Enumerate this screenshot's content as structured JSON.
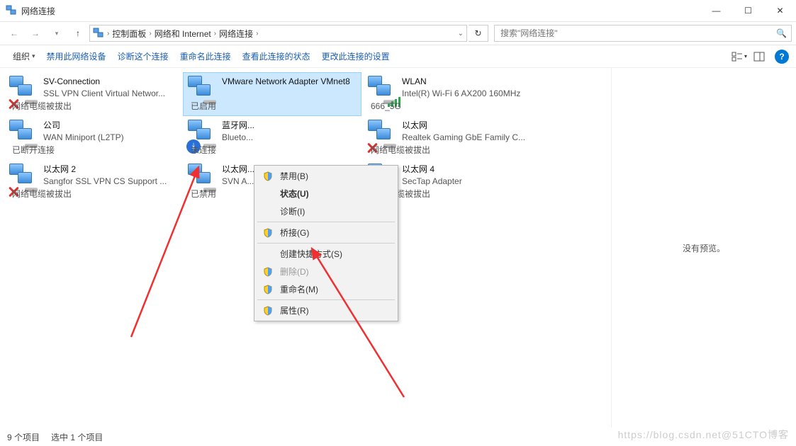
{
  "window": {
    "title": "网络连接",
    "winbuttons": {
      "min": "—",
      "max": "☐",
      "close": "✕"
    }
  },
  "nav": {
    "crumbs": [
      "控制面板",
      "网络和 Internet",
      "网络连接"
    ],
    "search_placeholder": "搜索\"网络连接\""
  },
  "cmdbar": {
    "organize": "组织",
    "disable": "禁用此网络设备",
    "diagnose": "诊断这个连接",
    "rename": "重命名此连接",
    "viewstatus": "查看此连接的状态",
    "changeconn": "更改此连接的设置"
  },
  "connections": [
    {
      "name": "SV-Connection",
      "status": "网络电缆被拔出",
      "device": "SSL VPN Client Virtual Networ...",
      "badge": "x"
    },
    {
      "name": "VMware Network Adapter VMnet8",
      "status": "已启用",
      "device": "",
      "badge": "",
      "selected": true
    },
    {
      "name": "WLAN",
      "status": "666_5G",
      "device": "Intel(R) Wi-Fi 6 AX200 160MHz",
      "badge": "bars"
    },
    {
      "name": "公司",
      "status": "已断开连接",
      "device": "WAN Miniport (L2TP)",
      "badge": ""
    },
    {
      "name": "蓝牙网...",
      "status": "未连接",
      "device": "Blueto...",
      "badge": "bt"
    },
    {
      "name": "以太网",
      "status": "网络电缆被拔出",
      "device": "Realtek Gaming GbE Family C...",
      "badge": "x"
    },
    {
      "name": "以太网 2",
      "status": "网络电缆被拔出",
      "device": "Sangfor SSL VPN CS Support ...",
      "badge": "x"
    },
    {
      "name": "以太网...",
      "status": "已禁用",
      "device": "SVN A...",
      "badge": ""
    },
    {
      "name": "以太网 4",
      "status": "网络电缆被拔出",
      "device": "SecTap Adapter",
      "badge": "x"
    }
  ],
  "context_menu": [
    {
      "label": "禁用(B)",
      "shield": true
    },
    {
      "label": "状态(U)",
      "bold": true
    },
    {
      "label": "诊断(I)"
    },
    {
      "sep": true
    },
    {
      "label": "桥接(G)",
      "shield": true
    },
    {
      "sep": true
    },
    {
      "label": "创建快捷方式(S)"
    },
    {
      "label": "删除(D)",
      "shield": true,
      "disabled": true
    },
    {
      "label": "重命名(M)",
      "shield": true
    },
    {
      "sep": true
    },
    {
      "label": "属性(R)",
      "shield": true
    }
  ],
  "preview_text": "没有预览。",
  "statusbar": {
    "items": "9 个项目",
    "selected": "选中 1 个项目"
  },
  "watermark": "https://blog.csdn.net@51CTO博客"
}
